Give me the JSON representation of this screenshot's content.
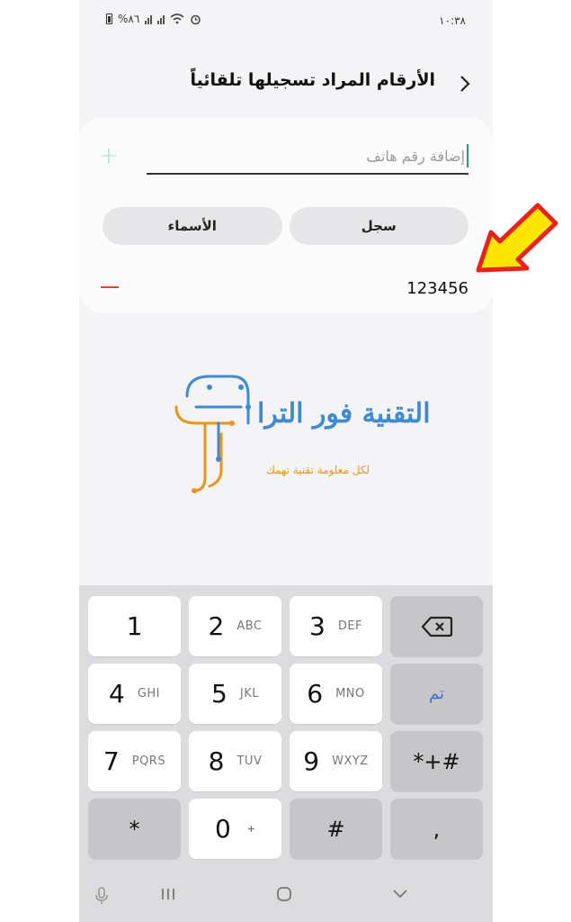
{
  "status_bar": {
    "time": "١٠:٣٨",
    "battery": "%٨٦"
  },
  "header": {
    "title": "الأرقام المراد تسجيلها تلقائياً",
    "back_glyph": "<"
  },
  "add_number": {
    "placeholder": "إضافة رقم هاتف",
    "add_glyph": "+"
  },
  "tabs": [
    {
      "label": "سجل"
    },
    {
      "label": "الأسماء"
    }
  ],
  "numbers": [
    {
      "value": "123456"
    }
  ],
  "watermark": {
    "title": "التقنية فور الترا",
    "subtitle": "لكل معلومة تقنية تهمك"
  },
  "keypad": {
    "rows": [
      [
        {
          "main": "1",
          "sub": ""
        },
        {
          "main": "2",
          "sub": "ABC"
        },
        {
          "main": "3",
          "sub": "DEF"
        },
        {
          "main": "backspace-icon",
          "sub": ""
        }
      ],
      [
        {
          "main": "4",
          "sub": "GHI"
        },
        {
          "main": "5",
          "sub": "JKL"
        },
        {
          "main": "6",
          "sub": "MNO"
        },
        {
          "main": "تم",
          "sub": ""
        }
      ],
      [
        {
          "main": "7",
          "sub": "PQRS"
        },
        {
          "main": "8",
          "sub": "TUV"
        },
        {
          "main": "9",
          "sub": "WXYZ"
        },
        {
          "main": "*+#",
          "sub": ""
        }
      ],
      [
        {
          "main": "*",
          "sub": ""
        },
        {
          "main": "0",
          "sub": "+"
        },
        {
          "main": "#",
          "sub": ""
        },
        {
          "main": ",",
          "sub": ""
        }
      ]
    ]
  },
  "navbar": [
    "mic-icon",
    "recents-icon",
    "home-icon",
    "hide-keyboard-icon"
  ],
  "colors": {
    "accent_green": "#2e9e6b",
    "remove_red": "#e0452b",
    "done_blue": "#3d6fd0",
    "arrow_yellow": "#ffe600",
    "arrow_red": "#e8231b"
  }
}
